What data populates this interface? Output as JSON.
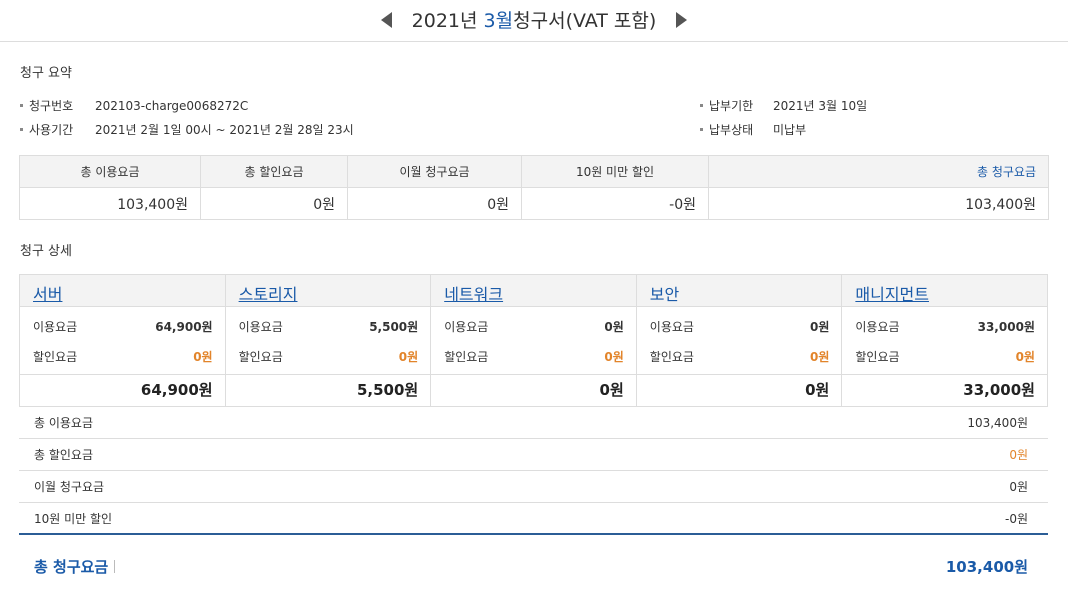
{
  "header": {
    "year_text": "2021년 ",
    "month_text": "3월",
    "title_rest": "청구서(VAT 포함)"
  },
  "summary": {
    "section_title": "청구 요약",
    "invoice_no_label": "청구번호",
    "invoice_no": "202103-charge0068272C",
    "period_label": "사용기간",
    "period": "2021년 2월 1일 00시 ~ 2021년 2월 28일 23시",
    "due_label": "납부기한",
    "due": "2021년 3월 10일",
    "status_label": "납부상태",
    "status": "미납부",
    "table": {
      "headers": [
        "총 이용요금",
        "총 할인요금",
        "이월 청구요금",
        "10원 미만 할인",
        "총 청구요금"
      ],
      "values": [
        "103,400원",
        "0원",
        "0원",
        "-0원",
        "103,400원"
      ]
    }
  },
  "detail": {
    "section_title": "청구 상세",
    "usage_label": "이용요금",
    "discount_label": "할인요금",
    "columns": [
      {
        "name": "서버",
        "usage": "64,900원",
        "discount": "0원",
        "total": "64,900원"
      },
      {
        "name": "스토리지",
        "usage": "5,500원",
        "discount": "0원",
        "total": "5,500원"
      },
      {
        "name": "네트워크",
        "usage": "0원",
        "discount": "0원",
        "total": "0원"
      },
      {
        "name": "보안",
        "usage": "0원",
        "discount": "0원",
        "total": "0원"
      },
      {
        "name": "매니지먼트",
        "usage": "33,000원",
        "discount": "0원",
        "total": "33,000원"
      }
    ]
  },
  "breakdown": [
    {
      "label": "총 이용요금",
      "value": "103,400원"
    },
    {
      "label": "총 할인요금",
      "value": "0원"
    },
    {
      "label": "이월 청구요금",
      "value": "0원"
    },
    {
      "label": "10원 미만 할인",
      "value": "-0원"
    }
  ],
  "grand_total": {
    "label": "총 청구요금",
    "value": "103,400원"
  },
  "colors": {
    "accent": "#1a5aa8",
    "discount": "#e2842a",
    "header_bg": "#f3f3f3",
    "border": "#dddddd"
  }
}
